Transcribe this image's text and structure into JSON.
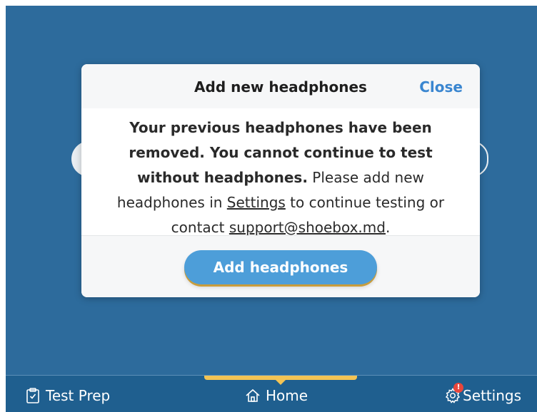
{
  "dialog": {
    "title": "Add new headphones",
    "close_label": "Close",
    "body": {
      "bold_text": "Your previous headphones have been removed. You cannot continue to test without headphones.",
      "text_before_settings": " Please add new headphones in ",
      "settings_link": "Settings",
      "text_after_settings": " to continue testing or contact ",
      "support_link": "support@shoebox.md",
      "text_end": "."
    },
    "button_label": "Add headphones"
  },
  "tabbar": {
    "tabs": [
      {
        "label": "Test Prep",
        "icon": "clipboard-check-icon"
      },
      {
        "label": "Home",
        "icon": "home-icon",
        "active": true
      },
      {
        "label": "Settings",
        "icon": "gear-icon",
        "badge": "!"
      }
    ]
  },
  "colors": {
    "background": "#2d6b9c",
    "tabbar": "#1f5f8f",
    "accent": "#4d9ed9",
    "link": "#3a86d0",
    "indicator": "#f3c455",
    "badge": "#e8463c"
  }
}
